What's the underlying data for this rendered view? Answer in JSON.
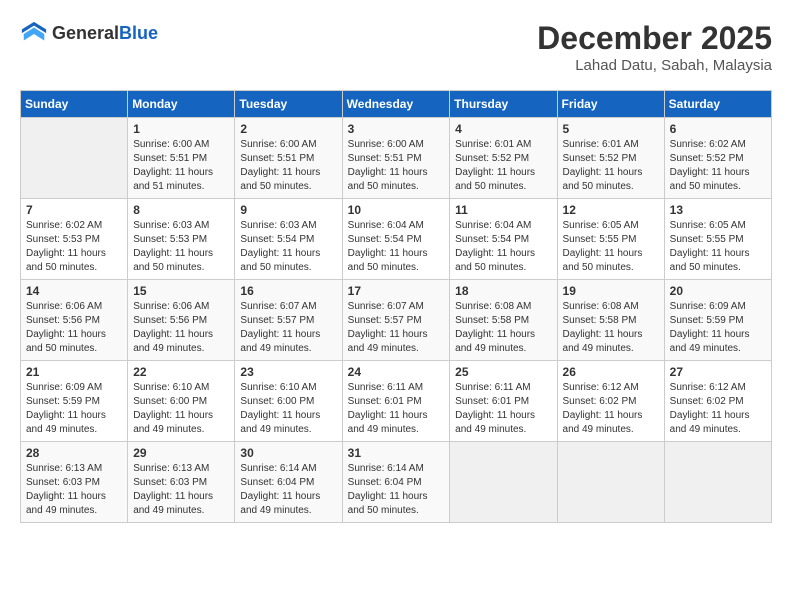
{
  "header": {
    "logo_general": "General",
    "logo_blue": "Blue",
    "month_year": "December 2025",
    "location": "Lahad Datu, Sabah, Malaysia"
  },
  "days_of_week": [
    "Sunday",
    "Monday",
    "Tuesday",
    "Wednesday",
    "Thursday",
    "Friday",
    "Saturday"
  ],
  "weeks": [
    [
      {
        "date": "",
        "sunrise": "",
        "sunset": "",
        "daylight": ""
      },
      {
        "date": "1",
        "sunrise": "Sunrise: 6:00 AM",
        "sunset": "Sunset: 5:51 PM",
        "daylight": "Daylight: 11 hours and 51 minutes."
      },
      {
        "date": "2",
        "sunrise": "Sunrise: 6:00 AM",
        "sunset": "Sunset: 5:51 PM",
        "daylight": "Daylight: 11 hours and 50 minutes."
      },
      {
        "date": "3",
        "sunrise": "Sunrise: 6:00 AM",
        "sunset": "Sunset: 5:51 PM",
        "daylight": "Daylight: 11 hours and 50 minutes."
      },
      {
        "date": "4",
        "sunrise": "Sunrise: 6:01 AM",
        "sunset": "Sunset: 5:52 PM",
        "daylight": "Daylight: 11 hours and 50 minutes."
      },
      {
        "date": "5",
        "sunrise": "Sunrise: 6:01 AM",
        "sunset": "Sunset: 5:52 PM",
        "daylight": "Daylight: 11 hours and 50 minutes."
      },
      {
        "date": "6",
        "sunrise": "Sunrise: 6:02 AM",
        "sunset": "Sunset: 5:52 PM",
        "daylight": "Daylight: 11 hours and 50 minutes."
      }
    ],
    [
      {
        "date": "7",
        "sunrise": "Sunrise: 6:02 AM",
        "sunset": "Sunset: 5:53 PM",
        "daylight": "Daylight: 11 hours and 50 minutes."
      },
      {
        "date": "8",
        "sunrise": "Sunrise: 6:03 AM",
        "sunset": "Sunset: 5:53 PM",
        "daylight": "Daylight: 11 hours and 50 minutes."
      },
      {
        "date": "9",
        "sunrise": "Sunrise: 6:03 AM",
        "sunset": "Sunset: 5:54 PM",
        "daylight": "Daylight: 11 hours and 50 minutes."
      },
      {
        "date": "10",
        "sunrise": "Sunrise: 6:04 AM",
        "sunset": "Sunset: 5:54 PM",
        "daylight": "Daylight: 11 hours and 50 minutes."
      },
      {
        "date": "11",
        "sunrise": "Sunrise: 6:04 AM",
        "sunset": "Sunset: 5:54 PM",
        "daylight": "Daylight: 11 hours and 50 minutes."
      },
      {
        "date": "12",
        "sunrise": "Sunrise: 6:05 AM",
        "sunset": "Sunset: 5:55 PM",
        "daylight": "Daylight: 11 hours and 50 minutes."
      },
      {
        "date": "13",
        "sunrise": "Sunrise: 6:05 AM",
        "sunset": "Sunset: 5:55 PM",
        "daylight": "Daylight: 11 hours and 50 minutes."
      }
    ],
    [
      {
        "date": "14",
        "sunrise": "Sunrise: 6:06 AM",
        "sunset": "Sunset: 5:56 PM",
        "daylight": "Daylight: 11 hours and 50 minutes."
      },
      {
        "date": "15",
        "sunrise": "Sunrise: 6:06 AM",
        "sunset": "Sunset: 5:56 PM",
        "daylight": "Daylight: 11 hours and 49 minutes."
      },
      {
        "date": "16",
        "sunrise": "Sunrise: 6:07 AM",
        "sunset": "Sunset: 5:57 PM",
        "daylight": "Daylight: 11 hours and 49 minutes."
      },
      {
        "date": "17",
        "sunrise": "Sunrise: 6:07 AM",
        "sunset": "Sunset: 5:57 PM",
        "daylight": "Daylight: 11 hours and 49 minutes."
      },
      {
        "date": "18",
        "sunrise": "Sunrise: 6:08 AM",
        "sunset": "Sunset: 5:58 PM",
        "daylight": "Daylight: 11 hours and 49 minutes."
      },
      {
        "date": "19",
        "sunrise": "Sunrise: 6:08 AM",
        "sunset": "Sunset: 5:58 PM",
        "daylight": "Daylight: 11 hours and 49 minutes."
      },
      {
        "date": "20",
        "sunrise": "Sunrise: 6:09 AM",
        "sunset": "Sunset: 5:59 PM",
        "daylight": "Daylight: 11 hours and 49 minutes."
      }
    ],
    [
      {
        "date": "21",
        "sunrise": "Sunrise: 6:09 AM",
        "sunset": "Sunset: 5:59 PM",
        "daylight": "Daylight: 11 hours and 49 minutes."
      },
      {
        "date": "22",
        "sunrise": "Sunrise: 6:10 AM",
        "sunset": "Sunset: 6:00 PM",
        "daylight": "Daylight: 11 hours and 49 minutes."
      },
      {
        "date": "23",
        "sunrise": "Sunrise: 6:10 AM",
        "sunset": "Sunset: 6:00 PM",
        "daylight": "Daylight: 11 hours and 49 minutes."
      },
      {
        "date": "24",
        "sunrise": "Sunrise: 6:11 AM",
        "sunset": "Sunset: 6:01 PM",
        "daylight": "Daylight: 11 hours and 49 minutes."
      },
      {
        "date": "25",
        "sunrise": "Sunrise: 6:11 AM",
        "sunset": "Sunset: 6:01 PM",
        "daylight": "Daylight: 11 hours and 49 minutes."
      },
      {
        "date": "26",
        "sunrise": "Sunrise: 6:12 AM",
        "sunset": "Sunset: 6:02 PM",
        "daylight": "Daylight: 11 hours and 49 minutes."
      },
      {
        "date": "27",
        "sunrise": "Sunrise: 6:12 AM",
        "sunset": "Sunset: 6:02 PM",
        "daylight": "Daylight: 11 hours and 49 minutes."
      }
    ],
    [
      {
        "date": "28",
        "sunrise": "Sunrise: 6:13 AM",
        "sunset": "Sunset: 6:03 PM",
        "daylight": "Daylight: 11 hours and 49 minutes."
      },
      {
        "date": "29",
        "sunrise": "Sunrise: 6:13 AM",
        "sunset": "Sunset: 6:03 PM",
        "daylight": "Daylight: 11 hours and 49 minutes."
      },
      {
        "date": "30",
        "sunrise": "Sunrise: 6:14 AM",
        "sunset": "Sunset: 6:04 PM",
        "daylight": "Daylight: 11 hours and 49 minutes."
      },
      {
        "date": "31",
        "sunrise": "Sunrise: 6:14 AM",
        "sunset": "Sunset: 6:04 PM",
        "daylight": "Daylight: 11 hours and 50 minutes."
      },
      {
        "date": "",
        "sunrise": "",
        "sunset": "",
        "daylight": ""
      },
      {
        "date": "",
        "sunrise": "",
        "sunset": "",
        "daylight": ""
      },
      {
        "date": "",
        "sunrise": "",
        "sunset": "",
        "daylight": ""
      }
    ]
  ]
}
